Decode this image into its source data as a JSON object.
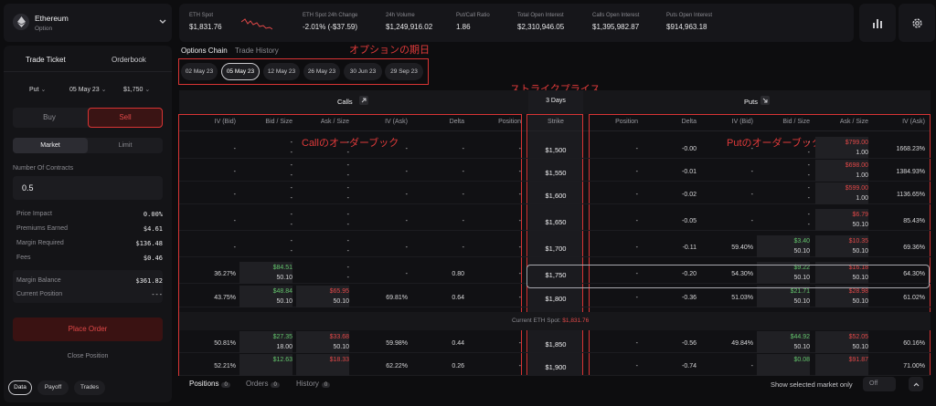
{
  "asset": {
    "name": "Ethereum",
    "type": "Option"
  },
  "stats": [
    {
      "label": "ETH Spot",
      "value": "$1,831.76",
      "color": "red"
    },
    {
      "label": "ETH Spot 24h Change",
      "value": "-2.01% (-$37.59)",
      "color": "red"
    },
    {
      "label": "24h Volume",
      "value": "$1,249,916.02"
    },
    {
      "label": "Put/Call Ratio",
      "value": "1.86"
    },
    {
      "label": "Total Open Interest",
      "value": "$2,310,946.05"
    },
    {
      "label": "Calls Open Interest",
      "value": "$1,395,982.87"
    },
    {
      "label": "Puts Open Interest",
      "value": "$914,963.18"
    }
  ],
  "ticket": {
    "tabs": [
      "Trade Ticket",
      "Orderbook"
    ],
    "type_select": "Put",
    "date_select": "05 May 23",
    "strike_select": "$1,750",
    "buy": "Buy",
    "sell": "Sell",
    "market": "Market",
    "limit": "Limit",
    "contracts_label": "Number Of Contracts",
    "contracts_value": "0.5",
    "rows": [
      {
        "k": "Price Impact",
        "v": "0.00%"
      },
      {
        "k": "Premiums Earned",
        "v": "$4.61"
      },
      {
        "k": "Margin Required",
        "v": "$136.48"
      },
      {
        "k": "Fees",
        "v": "$0.46"
      }
    ],
    "rows2": [
      {
        "k": "Margin Balance",
        "v": "$361.82"
      },
      {
        "k": "Current Position",
        "v": "---"
      }
    ],
    "place_order": "Place Order",
    "close_position": "Close Position",
    "bottom_tabs": [
      "Data",
      "Payoff",
      "Trades"
    ]
  },
  "chain": {
    "tabs": [
      "Options Chain",
      "Trade History"
    ],
    "expiries": [
      "02 May 23",
      "05 May 23",
      "12 May 23",
      "26 May 23",
      "30 Jun 23",
      "29 Sep 23"
    ],
    "calls_label": "Calls",
    "puts_label": "Puts",
    "days_label": "3 Days",
    "strike_header": "Strike",
    "call_headers": [
      "IV (Bid)",
      "Bid / Size",
      "Ask / Size",
      "IV (Ask)",
      "Delta",
      "Position"
    ],
    "put_headers": [
      "Position",
      "Delta",
      "IV (Bid)",
      "Bid / Size",
      "Ask / Size",
      "IV (Ask)"
    ],
    "current_spot_label": "Current ETH Spot:",
    "current_spot_value": "$1,831.76",
    "rows": [
      {
        "strike": "$1,500",
        "c_ivb": "-",
        "c_bid": "-",
        "c_bsz": "-",
        "c_ask": "-",
        "c_asz": "-",
        "c_iva": "-",
        "c_delta": "-",
        "c_pos": "-",
        "p_pos": "-",
        "p_delta": "-0.00",
        "p_ivb": "-",
        "p_bid": "-",
        "p_bsz": "-",
        "p_ask": "$799.00",
        "p_asz": "1.00",
        "p_iva": "1668.23%"
      },
      {
        "strike": "$1,550",
        "c_ivb": "-",
        "c_bid": "-",
        "c_bsz": "-",
        "c_ask": "-",
        "c_asz": "-",
        "c_iva": "-",
        "c_delta": "-",
        "c_pos": "-",
        "p_pos": "-",
        "p_delta": "-0.01",
        "p_ivb": "-",
        "p_bid": "-",
        "p_bsz": "-",
        "p_ask": "$698.00",
        "p_asz": "1.00",
        "p_iva": "1384.93%"
      },
      {
        "strike": "$1,600",
        "c_ivb": "-",
        "c_bid": "-",
        "c_bsz": "-",
        "c_ask": "-",
        "c_asz": "-",
        "c_iva": "-",
        "c_delta": "-",
        "c_pos": "-",
        "p_pos": "-",
        "p_delta": "-0.02",
        "p_ivb": "-",
        "p_bid": "-",
        "p_bsz": "-",
        "p_ask": "$599.00",
        "p_asz": "1.00",
        "p_iva": "1136.65%"
      },
      {
        "strike": "$1,650",
        "c_ivb": "-",
        "c_bid": "-",
        "c_bsz": "-",
        "c_ask": "-",
        "c_asz": "-",
        "c_iva": "-",
        "c_delta": "-",
        "c_pos": "-",
        "p_pos": "-",
        "p_delta": "-0.05",
        "p_ivb": "-",
        "p_bid": "-",
        "p_bsz": "-",
        "p_ask": "$6.79",
        "p_asz": "50.10",
        "p_iva": "85.43%"
      },
      {
        "strike": "$1,700",
        "c_ivb": "-",
        "c_bid": "-",
        "c_bsz": "-",
        "c_ask": "-",
        "c_asz": "-",
        "c_iva": "-",
        "c_delta": "-",
        "c_pos": "-",
        "p_pos": "-",
        "p_delta": "-0.11",
        "p_ivb": "59.40%",
        "p_bid": "$3.40",
        "p_bsz": "50.10",
        "p_ask": "$10.35",
        "p_asz": "50.10",
        "p_iva": "69.36%"
      },
      {
        "strike": "$1,750",
        "c_ivb": "36.27%",
        "c_bid": "$84.51",
        "c_bsz": "50.10",
        "c_ask": "-",
        "c_asz": "-",
        "c_iva": "-",
        "c_delta": "0.80",
        "c_pos": "-",
        "p_pos": "-",
        "p_delta": "-0.20",
        "p_ivb": "54.30%",
        "p_bid": "$9.22",
        "p_bsz": "50.10",
        "p_ask": "$16.18",
        "p_asz": "50.10",
        "p_iva": "64.30%"
      },
      {
        "strike": "$1,800",
        "c_ivb": "43.75%",
        "c_bid": "$48.84",
        "c_bsz": "50.10",
        "c_ask": "$65.95",
        "c_asz": "50.10",
        "c_iva": "69.81%",
        "c_delta": "0.64",
        "c_pos": "-",
        "p_pos": "-",
        "p_delta": "-0.36",
        "p_ivb": "51.03%",
        "p_bid": "$21.71",
        "p_bsz": "50.10",
        "p_ask": "$28.98",
        "p_asz": "50.10",
        "p_iva": "61.02%"
      },
      {
        "strike": "$1,850",
        "c_ivb": "50.81%",
        "c_bid": "$27.35",
        "c_bsz": "18.00",
        "c_ask": "$33.68",
        "c_asz": "50.10",
        "c_iva": "59.98%",
        "c_delta": "0.44",
        "c_pos": "-",
        "p_pos": "-",
        "p_delta": "-0.56",
        "p_ivb": "49.84%",
        "p_bid": "$44.92",
        "p_bsz": "50.10",
        "p_ask": "$52.05",
        "p_asz": "50.10",
        "p_iva": "60.16%"
      },
      {
        "strike": "$1,900",
        "c_ivb": "52.21%",
        "c_bid": "$12.63",
        "c_bsz": "",
        "c_ask": "$18.33",
        "c_asz": "",
        "c_iva": "62.22%",
        "c_delta": "0.26",
        "c_pos": "-",
        "p_pos": "-",
        "p_delta": "-0.74",
        "p_ivb": "-",
        "p_bid": "$0.08",
        "p_bsz": "",
        "p_ask": "$91.87",
        "p_asz": "",
        "p_iva": "71.00%"
      }
    ]
  },
  "annotations": {
    "expiry": "オプションの期日",
    "strike": "ストライクプライス",
    "call_book": "Callのオーダーブック",
    "put_book": "Putのオーダーブック"
  },
  "bottom": {
    "tabs": [
      {
        "label": "Positions",
        "count": "0"
      },
      {
        "label": "Orders",
        "count": "0"
      },
      {
        "label": "History",
        "count": "0"
      }
    ],
    "toggle_label": "Show selected market only",
    "toggle_value": "Off"
  }
}
